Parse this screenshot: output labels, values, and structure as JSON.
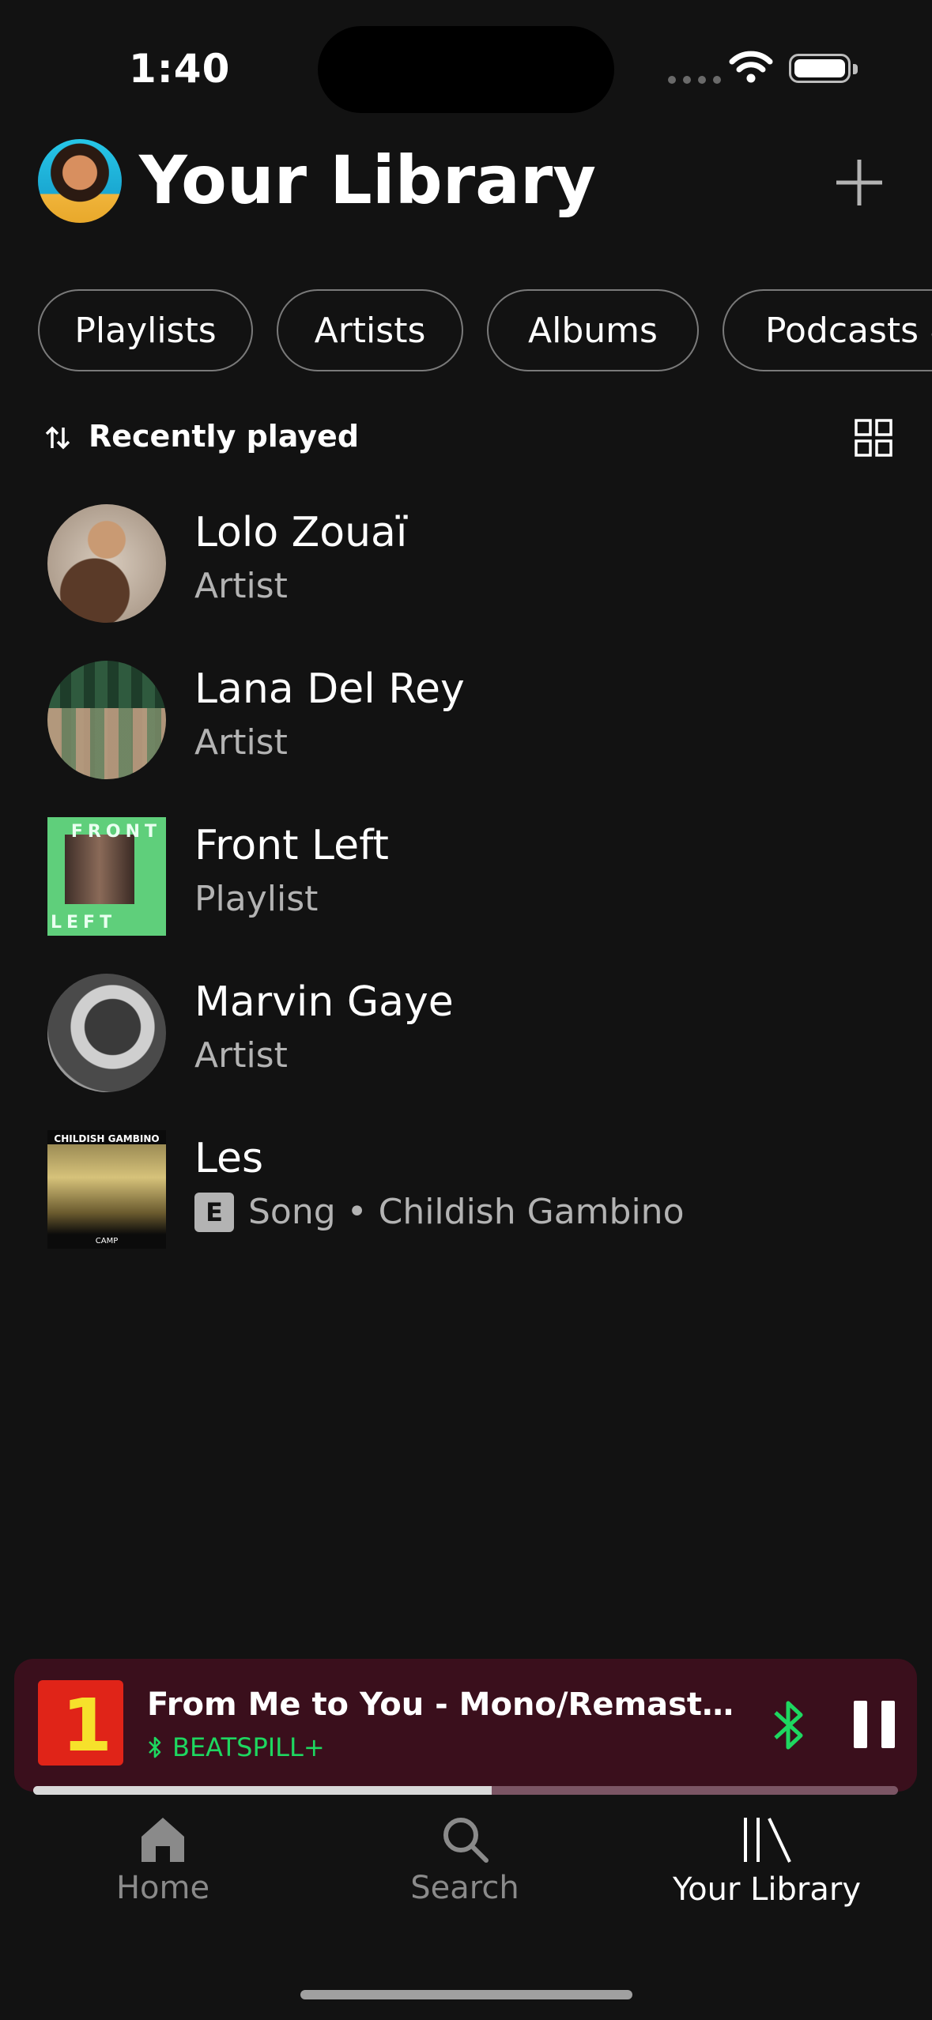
{
  "status_bar": {
    "time": "1:40"
  },
  "header": {
    "title": "Your Library"
  },
  "filters": [
    "Playlists",
    "Artists",
    "Albums",
    "Podcasts &"
  ],
  "sort": {
    "label": "Recently played"
  },
  "items": [
    {
      "name": "Lolo Zouaï",
      "sub": "Artist"
    },
    {
      "name": "Lana Del Rey",
      "sub": "Artist"
    },
    {
      "name": "Front Left",
      "sub": "Playlist",
      "art_text_top": "FRONT",
      "art_text_bottom": "LEFT"
    },
    {
      "name": "Marvin Gaye",
      "sub": "Artist"
    },
    {
      "name": "Les",
      "explicit": "E",
      "sub": "Song • Childish Gambino",
      "art_text_top": "CHILDISH GAMBINO",
      "art_text_bottom": "CAMP"
    }
  ],
  "now_playing": {
    "title": "From Me to You - Mono/Remastered…",
    "device": "BEATSPILL+",
    "art_text": "1",
    "progress": 0.53,
    "accent": "#1ed760",
    "background": "#3a0f1c"
  },
  "tabs": [
    {
      "label": "Home",
      "icon": "home-icon"
    },
    {
      "label": "Search",
      "icon": "search-icon"
    },
    {
      "label": "Your Library",
      "icon": "library-icon",
      "active": true
    }
  ]
}
